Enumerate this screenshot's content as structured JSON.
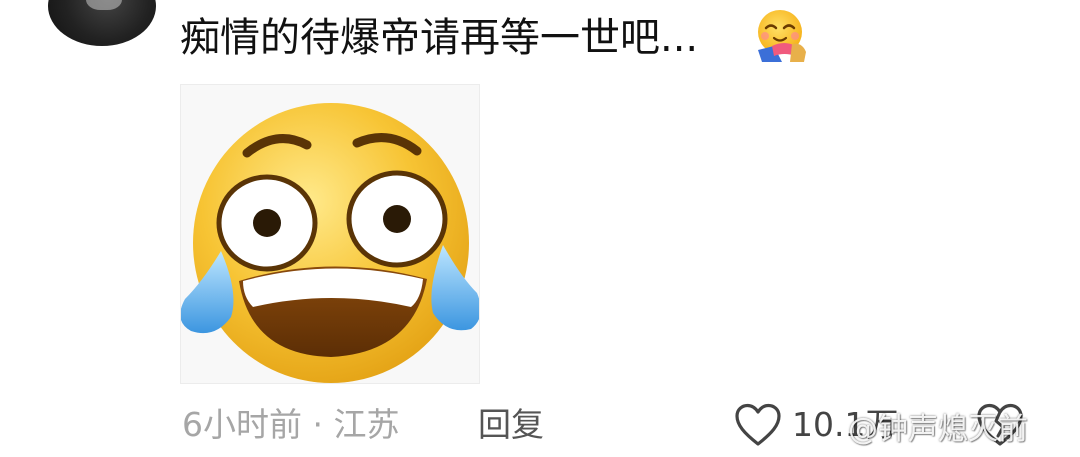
{
  "comment": {
    "text": "痴情的待爆帝请再等一世吧...",
    "emoji": "smiling-face-with-hearts-hugging-icon"
  },
  "sticker": {
    "name": "laughing-crying-face-sticker"
  },
  "meta": {
    "time": "6小时前",
    "separator": " · ",
    "location": "江苏"
  },
  "actions": {
    "reply_label": "回复",
    "like_count": "10.1万",
    "like_icon": "heart-outline-icon",
    "dislike_icon": "broken-heart-icon"
  },
  "watermark": {
    "text": "@钟声熄灭前"
  },
  "colors": {
    "meta_text": "#a6a6a6",
    "reply_text": "#555555",
    "primary_text": "#111111"
  }
}
